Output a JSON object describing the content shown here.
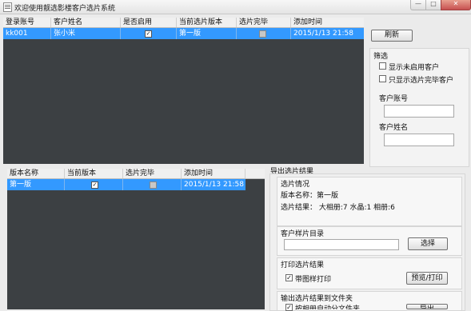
{
  "window": {
    "title": "欢迎使用靓选影楼客户选片系统",
    "min_glyph": "—",
    "max_glyph": "□",
    "close_glyph": "✕"
  },
  "customers_grid": {
    "columns": [
      "登录账号",
      "客户姓名",
      "是否启用",
      "当前选片版本",
      "选片完毕",
      "添加时间"
    ],
    "rows": [
      {
        "account": "kk001",
        "name": "张小米",
        "enabled": true,
        "version": "第一版",
        "finished": false,
        "added": "2015/1/13 21:58"
      }
    ]
  },
  "refresh_label": "刷新",
  "filter": {
    "title": "筛选",
    "show_disabled_label": "显示未启用客户",
    "show_finished_label": "只显示选片完毕客户",
    "account_label": "客户账号",
    "account_value": "",
    "name_label": "客户姓名",
    "name_value": ""
  },
  "versions_grid": {
    "columns": [
      "版本名称",
      "当前版本",
      "选片完毕",
      "添加时间"
    ],
    "rows": [
      {
        "version_name": "第一版",
        "current": true,
        "finished": false,
        "added": "2015/1/13 21:58"
      }
    ]
  },
  "export": {
    "title": "导出选片结果",
    "situation": {
      "title": "选片情况",
      "version_text": "版本名称：第一版",
      "result_text": "选片结果： 大相册:7 水晶:1 相册:6"
    },
    "sample_dir": {
      "title": "客户样片目录",
      "value": "",
      "choose_label": "选择"
    },
    "print": {
      "title": "打印选片结果",
      "with_thumb_label": "带图样打印",
      "with_thumb_checked": true,
      "preview_label": "预览/打印"
    },
    "to_folder": {
      "title": "输出选片结果到文件夹",
      "auto_folder_label": "按相册自动分文件夹",
      "auto_folder_checked": true,
      "output_label": "导出"
    }
  },
  "colors": {
    "grid_bg": "#3c4043",
    "selection": "#3399ff"
  }
}
